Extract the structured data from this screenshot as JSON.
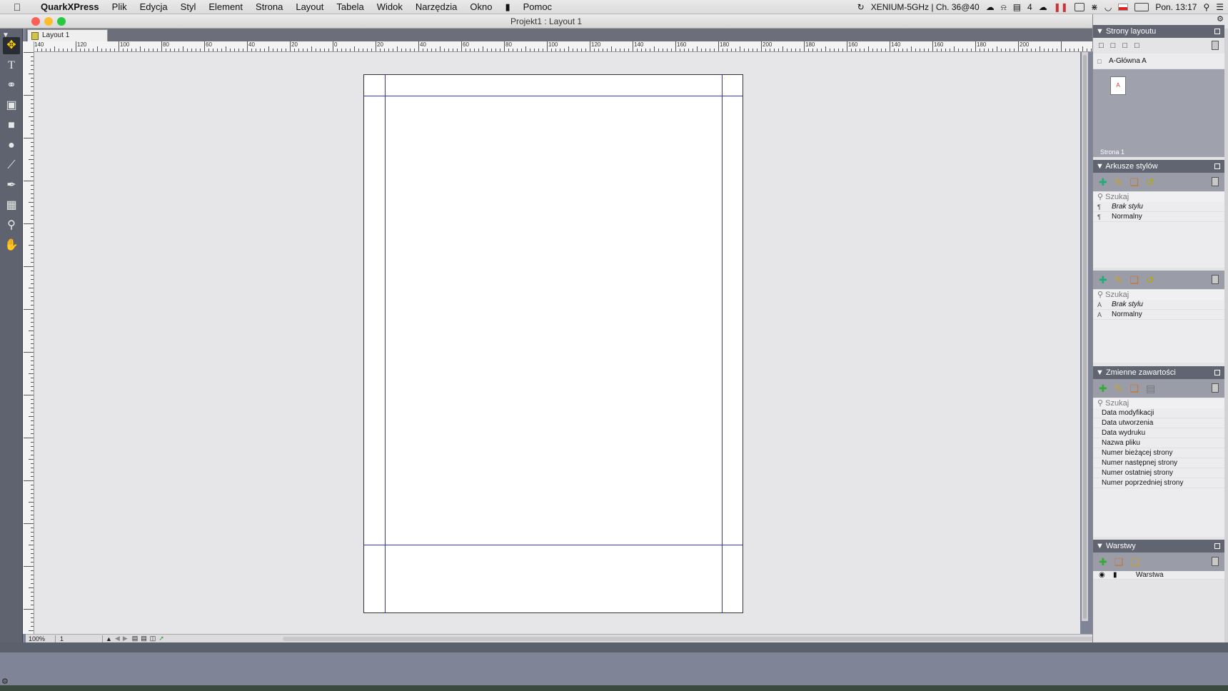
{
  "menubar": {
    "app_name": "QuarkXPress",
    "items": [
      "Plik",
      "Edycja",
      "Styl",
      "Element",
      "Strona",
      "Layout",
      "Tabela",
      "Widok",
      "Narzędzia",
      "Okno",
      "Pomoc"
    ],
    "wifi_label": "XENIUM-5GHz | Ch. 36@40",
    "badge_count": "4",
    "clock": "Pon. 13:17"
  },
  "window": {
    "title": "Projekt1 : Layout 1",
    "tab_label": "Layout 1"
  },
  "rulers": {
    "h_labels": [
      "140",
      "120",
      "100",
      "80",
      "60",
      "40",
      "20",
      "0",
      "20",
      "40",
      "60",
      "80",
      "100",
      "120",
      "140",
      "160",
      "180",
      "200",
      "180",
      "160",
      "140",
      "160",
      "180",
      "200"
    ]
  },
  "status": {
    "zoom": "100%",
    "page": "1"
  },
  "panels": {
    "pages": {
      "title": "Strony layoutu",
      "master_label": "A-Główna A",
      "thumb_letter": "A",
      "page_label": "Strona 1"
    },
    "styles": {
      "title": "Arkusze stylów",
      "search_placeholder": "Szukaj",
      "paragraph_styles": [
        "Brak stylu",
        "Normalny"
      ],
      "character_styles": [
        "Brak stylu",
        "Normalny"
      ]
    },
    "variables": {
      "title": "Zmienne zawartości",
      "search_placeholder": "Szukaj",
      "items": [
        "Data modyfikacji",
        "Data utworzenia",
        "Data wydruku",
        "Nazwa pliku",
        "Numer bieżącej strony",
        "Numer następnej strony",
        "Numer ostatniej strony",
        "Numer poprzedniej strony"
      ]
    },
    "layers": {
      "title": "Warstwy",
      "layer_name": "Warstwa"
    }
  },
  "colors": {
    "guide": "#3434c8",
    "panel_header": "#616471"
  }
}
